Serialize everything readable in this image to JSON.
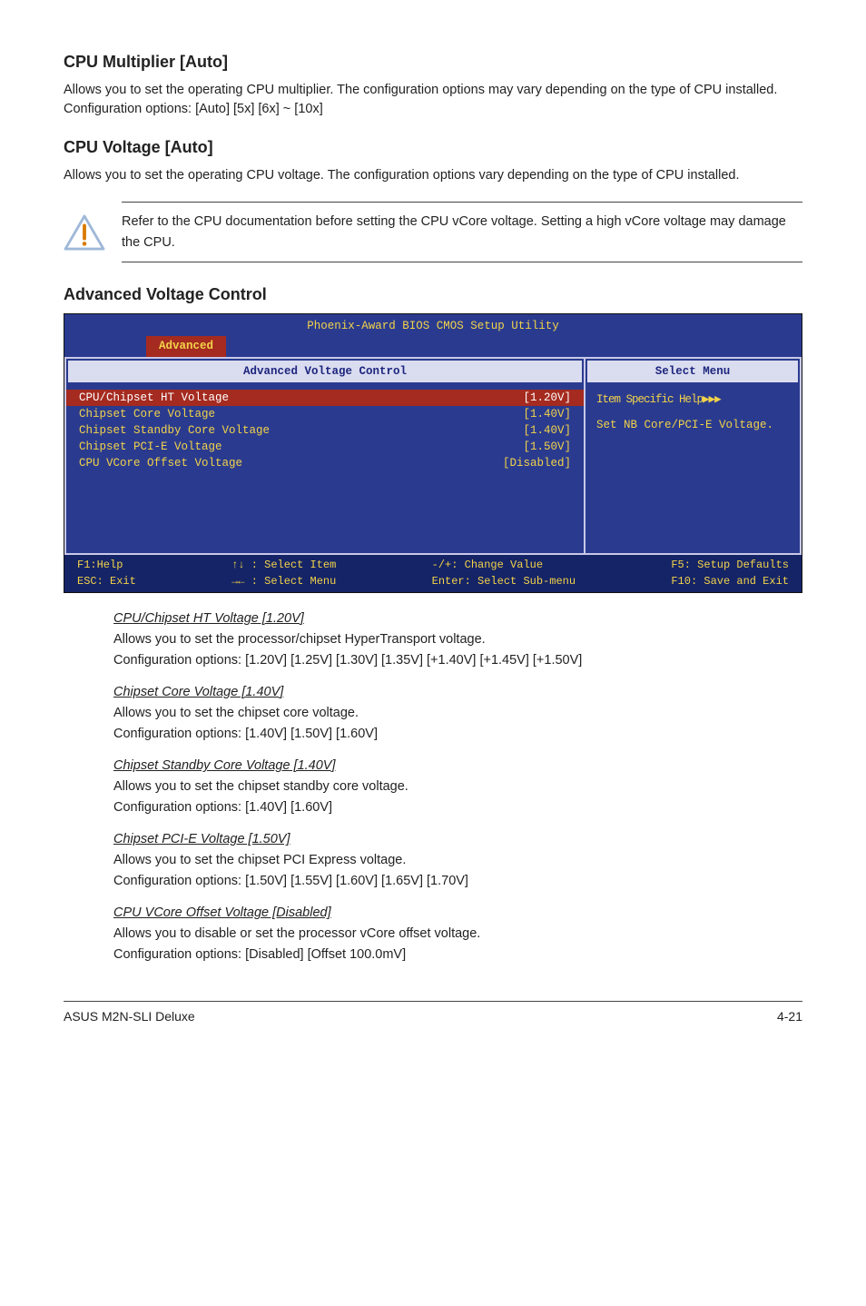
{
  "sections": {
    "cpu_multiplier": {
      "heading": "CPU Multiplier [Auto]",
      "body": "Allows you to set the operating CPU multiplier. The configuration options may vary depending on the type of CPU installed. Configuration options: [Auto] [5x] [6x] ~ [10x]"
    },
    "cpu_voltage": {
      "heading": "CPU Voltage [Auto]",
      "body": "Allows you to set the operating CPU voltage. The configuration options vary depending on the type of CPU installed."
    },
    "note": "Refer to the CPU documentation before setting the CPU vCore voltage. Setting a high vCore voltage may damage the CPU.",
    "advanced_heading": "Advanced Voltage Control"
  },
  "bios": {
    "title": "Phoenix-Award BIOS CMOS Setup Utility",
    "tab": "Advanced",
    "left_header": "Advanced Voltage Control",
    "right_header": "Select Menu",
    "fields": [
      {
        "label": "CPU/Chipset HT Voltage",
        "value": "[1.20V]",
        "selected": true
      },
      {
        "label": "Chipset Core Voltage",
        "value": "[1.40V]",
        "selected": false
      },
      {
        "label": "Chipset Standby Core Voltage",
        "value": "[1.40V]",
        "selected": false
      },
      {
        "label": "Chipset PCI-E Voltage",
        "value": "[1.50V]",
        "selected": false
      },
      {
        "label": "CPU VCore Offset Voltage",
        "value": "[Disabled]",
        "selected": false
      }
    ],
    "help1": "Item Specific Help▶▶▶",
    "help2": "Set NB Core/PCI-E Voltage.",
    "footer": {
      "c1a": "F1:Help",
      "c1b": "ESC: Exit",
      "c2a": "↑↓ : Select Item",
      "c2b": "→← : Select Menu",
      "c3a": "-/+: Change Value",
      "c3b": "Enter: Select Sub-menu",
      "c4a": "F5: Setup Defaults",
      "c4b": "F10: Save and Exit"
    }
  },
  "subitems": [
    {
      "title": "CPU/Chipset HT Voltage [1.20V]",
      "l1": "Allows you to set the processor/chipset HyperTransport voltage.",
      "l2": "Configuration options: [1.20V] [1.25V] [1.30V] [1.35V] [+1.40V] [+1.45V] [+1.50V]"
    },
    {
      "title": "Chipset Core Voltage [1.40V]",
      "l1": "Allows you to set the chipset core voltage.",
      "l2": "Configuration options: [1.40V] [1.50V] [1.60V]"
    },
    {
      "title": "Chipset Standby Core Voltage [1.40V]",
      "l1": "Allows you to set the chipset standby core voltage.",
      "l2": "Configuration options:  [1.40V] [1.60V]"
    },
    {
      "title": "Chipset PCI-E Voltage [1.50V]",
      "l1": "Allows you to set the chipset PCI Express voltage.",
      "l2": "Configuration options: [1.50V] [1.55V] [1.60V] [1.65V] [1.70V]"
    },
    {
      "title": "CPU VCore Offset Voltage [Disabled]",
      "l1": "Allows you to disable or set the processor vCore offset voltage.",
      "l2": "Configuration options: [Disabled] [Offset 100.0mV]"
    }
  ],
  "footer": {
    "left": "ASUS M2N-SLI Deluxe",
    "right": "4-21"
  }
}
